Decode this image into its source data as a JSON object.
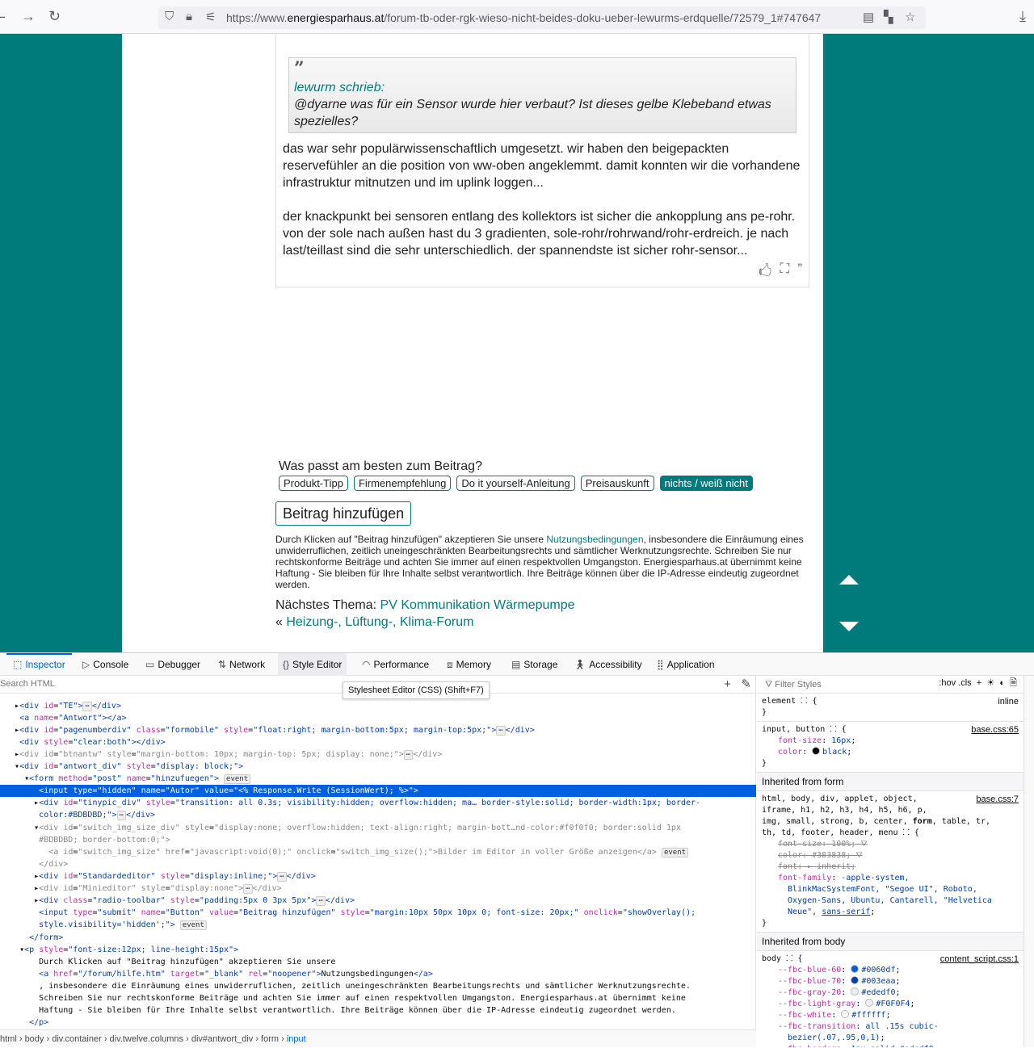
{
  "browser": {
    "url_prefix": "https://www.",
    "url_domain": "energiesparhaus.at",
    "url_path": "/forum-tb-oder-rgk-wieso-nicht-beides-doku-ueber-lewurms-erdquelle/72579_1#747647"
  },
  "post": {
    "quote_mark": "”",
    "quote_author": "lewurm schrieb:",
    "quote_text": "@dyarne was für ein Sensor wurde hier verbaut? Ist dieses gelbe Klebeband etwas spezielles?",
    "para1": "das war sehr populärwissenschaftlich umgesetzt. wir haben den beigepackten reservefühler an die position von ww-oben angeklemmt. damit konnten wir die vorhandene infrastruktur mitnutzen und im uplink loggen...",
    "para2": "der knackpunkt bei sensoren entlang des kollektors ist sicher die ankopplung ans pe-rohr. von der sole nach außen hast du 3 gradienten, sole-rohr/rohrwand/rohr-erdreich. je nach last/teillast sind die sehr unterschiedlich. der spannendste ist sicher rohr-sensor..."
  },
  "rating": {
    "title": "Was passt am besten zum Beitrag?",
    "options": [
      "Produkt-Tipp",
      "Firmenempfehlung",
      "Do it yourself-Anleitung",
      "Preisauskunft",
      "nichts / weiß nicht"
    ]
  },
  "submit_label": "Beitrag hinzufügen",
  "terms": {
    "before": "Durch Klicken auf \"Beitrag hinzufügen\" akzeptieren Sie unsere ",
    "link": "Nutzungsbedingungen",
    "after": ", insbesondere die Einräumung eines unwiderruflichen, zeitlich uneingeschränkten Bearbeitungsrechts und sämtlicher Werknutzungsrechte. Schreiben Sie nur rechtskonforme Beiträge und achten Sie immer auf einen respektvollen Umgangston. Energiesparhaus.at übernimmt keine Haftung - Sie bleiben für Ihre Inhalte selbst verantwortlich. Ihre Beiträge können über die IP-Adresse eindeutig zugeordnet werden."
  },
  "nav": {
    "next_label": "Nächstes Thema: ",
    "next_link": "PV Kommunikation Wärmepumpe",
    "back_prefix": "« ",
    "back_link": "Heizung-, Lüftung-, Klima-Forum"
  },
  "devtools": {
    "tabs": [
      "Inspector",
      "Console",
      "Debugger",
      "Network",
      "Style Editor",
      "Performance",
      "Memory",
      "Storage",
      "Accessibility",
      "Application"
    ],
    "tooltip": "Stylesheet Editor (CSS) (Shift+F7)",
    "search_placeholder": "Search HTML",
    "filter_placeholder": "Filter Styles",
    "filter_tools": ":hov  .cls",
    "breadcrumbs": [
      "html",
      "body",
      "div.container",
      "div.twelve.columns",
      "div#antwort_div",
      "form",
      "input"
    ],
    "inherited_form": "Inherited from form",
    "inherited_body": "Inherited from body",
    "colors": {
      "fbc_blue_60": "#0060df",
      "fbc_blue_70": "#003eaa",
      "fbc_gray_20": "#ededf0",
      "fbc_light_gray": "#F0F0F4",
      "fbc_white": "#ffffff"
    }
  }
}
